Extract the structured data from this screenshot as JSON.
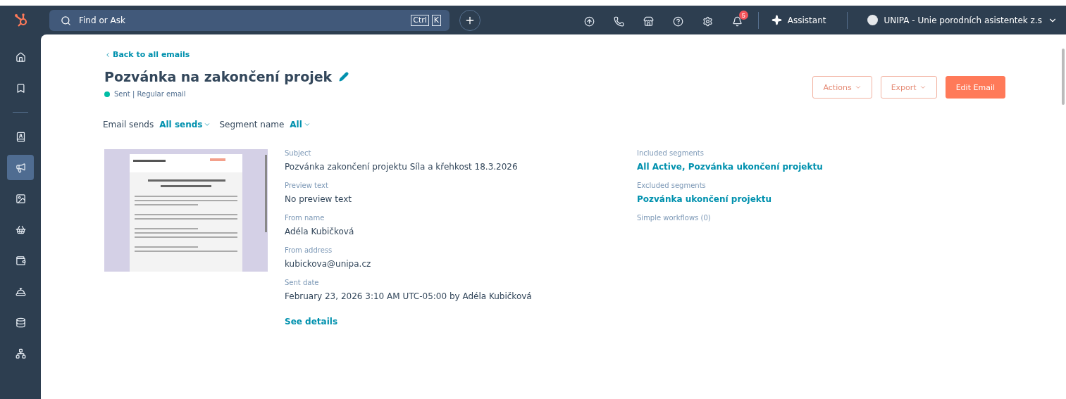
{
  "topbar": {
    "search": {
      "placeholder": "Find or Ask"
    },
    "shortcut": [
      "Ctrl",
      "K"
    ],
    "icons": [
      {
        "kind": "upload"
      },
      {
        "kind": "phone"
      },
      {
        "kind": "store"
      },
      {
        "kind": "help"
      },
      {
        "kind": "settings"
      },
      {
        "kind": "bell",
        "badge": "5"
      }
    ],
    "assistant": "Assistant",
    "account": "UNIPA - Unie porodních asistentek z.s"
  },
  "sidebar": {
    "items": [
      {
        "kind": "home",
        "selected": false
      },
      {
        "kind": "bookmark",
        "selected": false
      },
      {
        "kind": "divider"
      },
      {
        "kind": "contacts",
        "selected": false
      },
      {
        "kind": "marketing",
        "selected": true
      },
      {
        "kind": "content",
        "selected": false
      },
      {
        "kind": "commerce",
        "selected": false
      },
      {
        "kind": "wallet",
        "selected": false
      },
      {
        "kind": "service",
        "selected": false
      },
      {
        "kind": "data",
        "selected": false
      },
      {
        "kind": "more",
        "selected": false
      }
    ]
  },
  "back_link": "Back to all emails",
  "title": "Pozvánka na zakončení projek",
  "status": {
    "color": "#00bda5",
    "text": "Sent | Regular email"
  },
  "actions": [
    {
      "label": "Actions",
      "kind": "dropdown"
    },
    {
      "label": "Export",
      "kind": "dropdown"
    },
    {
      "label": "Edit Email",
      "kind": "primary"
    }
  ],
  "filters": [
    {
      "label": "Email sends",
      "value": "All sends"
    },
    {
      "label": "Segment name",
      "value": "All"
    }
  ],
  "details": [
    {
      "label": "Subject",
      "value": "Pozvánka zakončení projektu Síla a křehkost 18.3.2026"
    },
    {
      "label": "Preview text",
      "value": "No preview text"
    },
    {
      "label": "From name",
      "value": "Adéla Kubičková"
    },
    {
      "label": "From address",
      "value": "kubickova@unipa.cz"
    },
    {
      "label": "Sent date",
      "value": "February 23, 2026 3:10 AM UTC-05:00 by Adéla Kubičková"
    }
  ],
  "see_details": "See details",
  "segments": [
    {
      "label": "Included segments",
      "value": "All Active, Pozvánka ukončení projektu"
    },
    {
      "label": "Excluded segments",
      "value": "Pozvánka ukončení projektu"
    },
    {
      "label": "Simple workflows (0)"
    }
  ]
}
